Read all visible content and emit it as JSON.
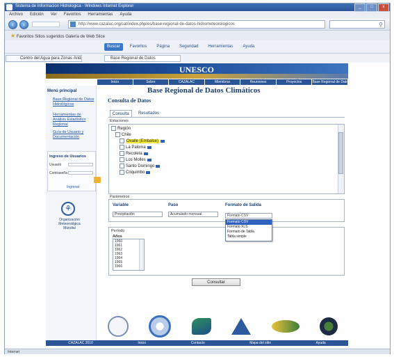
{
  "browser": {
    "title": "Sistema de Informacion Hidrologica - Windows Internet Explorer",
    "window_buttons": [
      "_",
      "□",
      "x"
    ],
    "menu": [
      "Archivo",
      "Edición",
      "Ver",
      "Favoritos",
      "Herramientas",
      "Ayuda"
    ],
    "address": "http://www.cazalac.org/cat/index.php/es/base-regional-de-datos-hidrometeorologicos",
    "favorites": "Favoritos   Sitios sugeridos  Galería de Web Slice",
    "tab_label": "Centro del Agua para Zonas Áridas y Semiáridas",
    "tab2_label": "Base Regional de Datos",
    "toolbar_buttons": [
      "Buscar",
      "Favoritos",
      "Página",
      "Seguridad",
      "Herramientas",
      "Ayuda"
    ],
    "status": "Internet"
  },
  "site": {
    "logo_text": "UNESCO",
    "nav_links": [
      "Inicio",
      "Sobre",
      "CAZALAC",
      "Miembros",
      "Reuniones",
      "Proyectos",
      "Base Regional de Datos"
    ],
    "footer_links": [
      "CAZALAC 2010",
      "Inicio",
      "Contacto",
      "Mapa del sitio",
      "Ayuda"
    ]
  },
  "sidebar": {
    "heading": "Menú principal",
    "links": [
      "Base Regional de Datos Hidrológicos",
      "Herramientas de Análisis Estadístico Regional",
      "Guía de Usuario y Documentación"
    ],
    "login_title": "Ingreso de Usuarios",
    "login_user": "Usuario",
    "login_pass": "Contraseña",
    "login_button": "Ingresar",
    "wmo_caption": "Organización Meteorológica Mundial"
  },
  "main": {
    "title": "Base Regional de Datos Climáticos",
    "subtitle": "Consulta de Datos",
    "tabs": [
      "Consulta",
      "Resultados"
    ],
    "stations_label": "Estaciones",
    "tree_root": "Región",
    "tree_country": "Chile",
    "tree_items": [
      "Ovalle (Embalse)",
      "La Paloma",
      "Recoleta",
      "Los Molles",
      "Santo Domingo",
      "Coquimbo"
    ],
    "params_label": "Parámetros",
    "col_variable": "Variable",
    "col_period": "Paso",
    "col_format": "Formato de Salida",
    "variable_value": "Precipitación",
    "period_value": "Acumulado mensual",
    "format_value": "Formato CSV",
    "format_options": [
      "Formato CSV",
      "Formato XLS",
      "Formato de Tabla",
      "Tabla simple"
    ],
    "dates_label": "Período",
    "years_label": "Años",
    "years": [
      "1960",
      "1961",
      "1962",
      "1963",
      "1964",
      "1965",
      "1966"
    ],
    "submit": "Consultar"
  },
  "colors": {
    "header_dark": "#0b2f6b",
    "accent": "#2c5595",
    "highlight": "#f4ec3a"
  }
}
